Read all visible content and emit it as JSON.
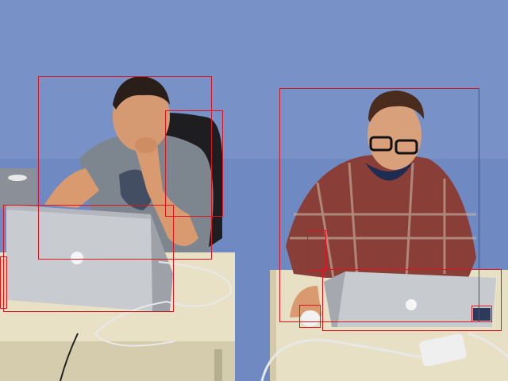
{
  "scene": {
    "colors": {
      "wall": "#6e89c0",
      "wall_light": "#8aa3d2",
      "desk": "#e7e0c4",
      "desk_edge": "#cfc7a8",
      "laptop": "#c9ccd1",
      "laptop_dark": "#9ea2a8",
      "box": "#e0141e",
      "shirt_gray": "#7d858f",
      "shirt_plaid": "#8a3e38",
      "skin": "#d99a70",
      "hair": "#2a1f18",
      "chair": "#1d1d1f"
    },
    "annotations": [
      {
        "category": "person",
        "id": "person-left"
      },
      {
        "category": "chair",
        "id": "chair"
      },
      {
        "category": "laptop",
        "id": "laptop-left"
      },
      {
        "category": "person",
        "id": "person-right"
      },
      {
        "category": "laptop",
        "id": "laptop-right"
      },
      {
        "category": "mouse",
        "id": "mouse"
      },
      {
        "category": "cup",
        "id": "cup"
      },
      {
        "category": "object",
        "id": "small-object"
      },
      {
        "category": "object",
        "id": "left-edge-object"
      }
    ]
  }
}
